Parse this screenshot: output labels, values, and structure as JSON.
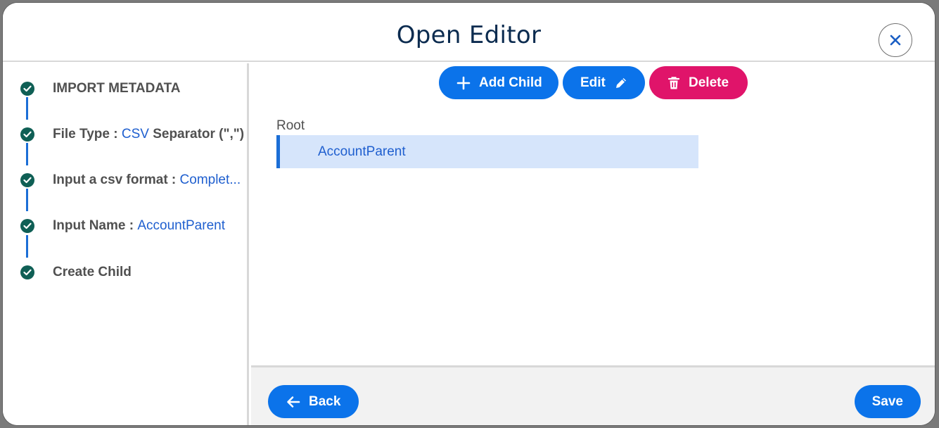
{
  "dialog": {
    "title": "Open Editor",
    "close_icon": "close-icon"
  },
  "steps": [
    {
      "label": "IMPORT METADATA",
      "value": ""
    },
    {
      "label": "File Type : ",
      "value": "CSV",
      "suffix": " Separator (\",\")"
    },
    {
      "label": "Input a csv format : ",
      "value": "Complet..."
    },
    {
      "label": "Input Name : ",
      "value": "AccountParent"
    },
    {
      "label": "Create Child",
      "value": ""
    }
  ],
  "toolbar": {
    "add_child_label": "Add Child",
    "edit_label": "Edit",
    "delete_label": "Delete"
  },
  "tree": {
    "root_label": "Root",
    "items": [
      {
        "label": "AccountParent",
        "selected": true
      }
    ]
  },
  "footer": {
    "back_label": "Back",
    "save_label": "Save"
  },
  "colors": {
    "primary": "#0b73ea",
    "danger": "#e0146a",
    "step_done": "#0f5f55",
    "selected_row": "#d6e5fb",
    "link_text": "#1f5fcf"
  }
}
